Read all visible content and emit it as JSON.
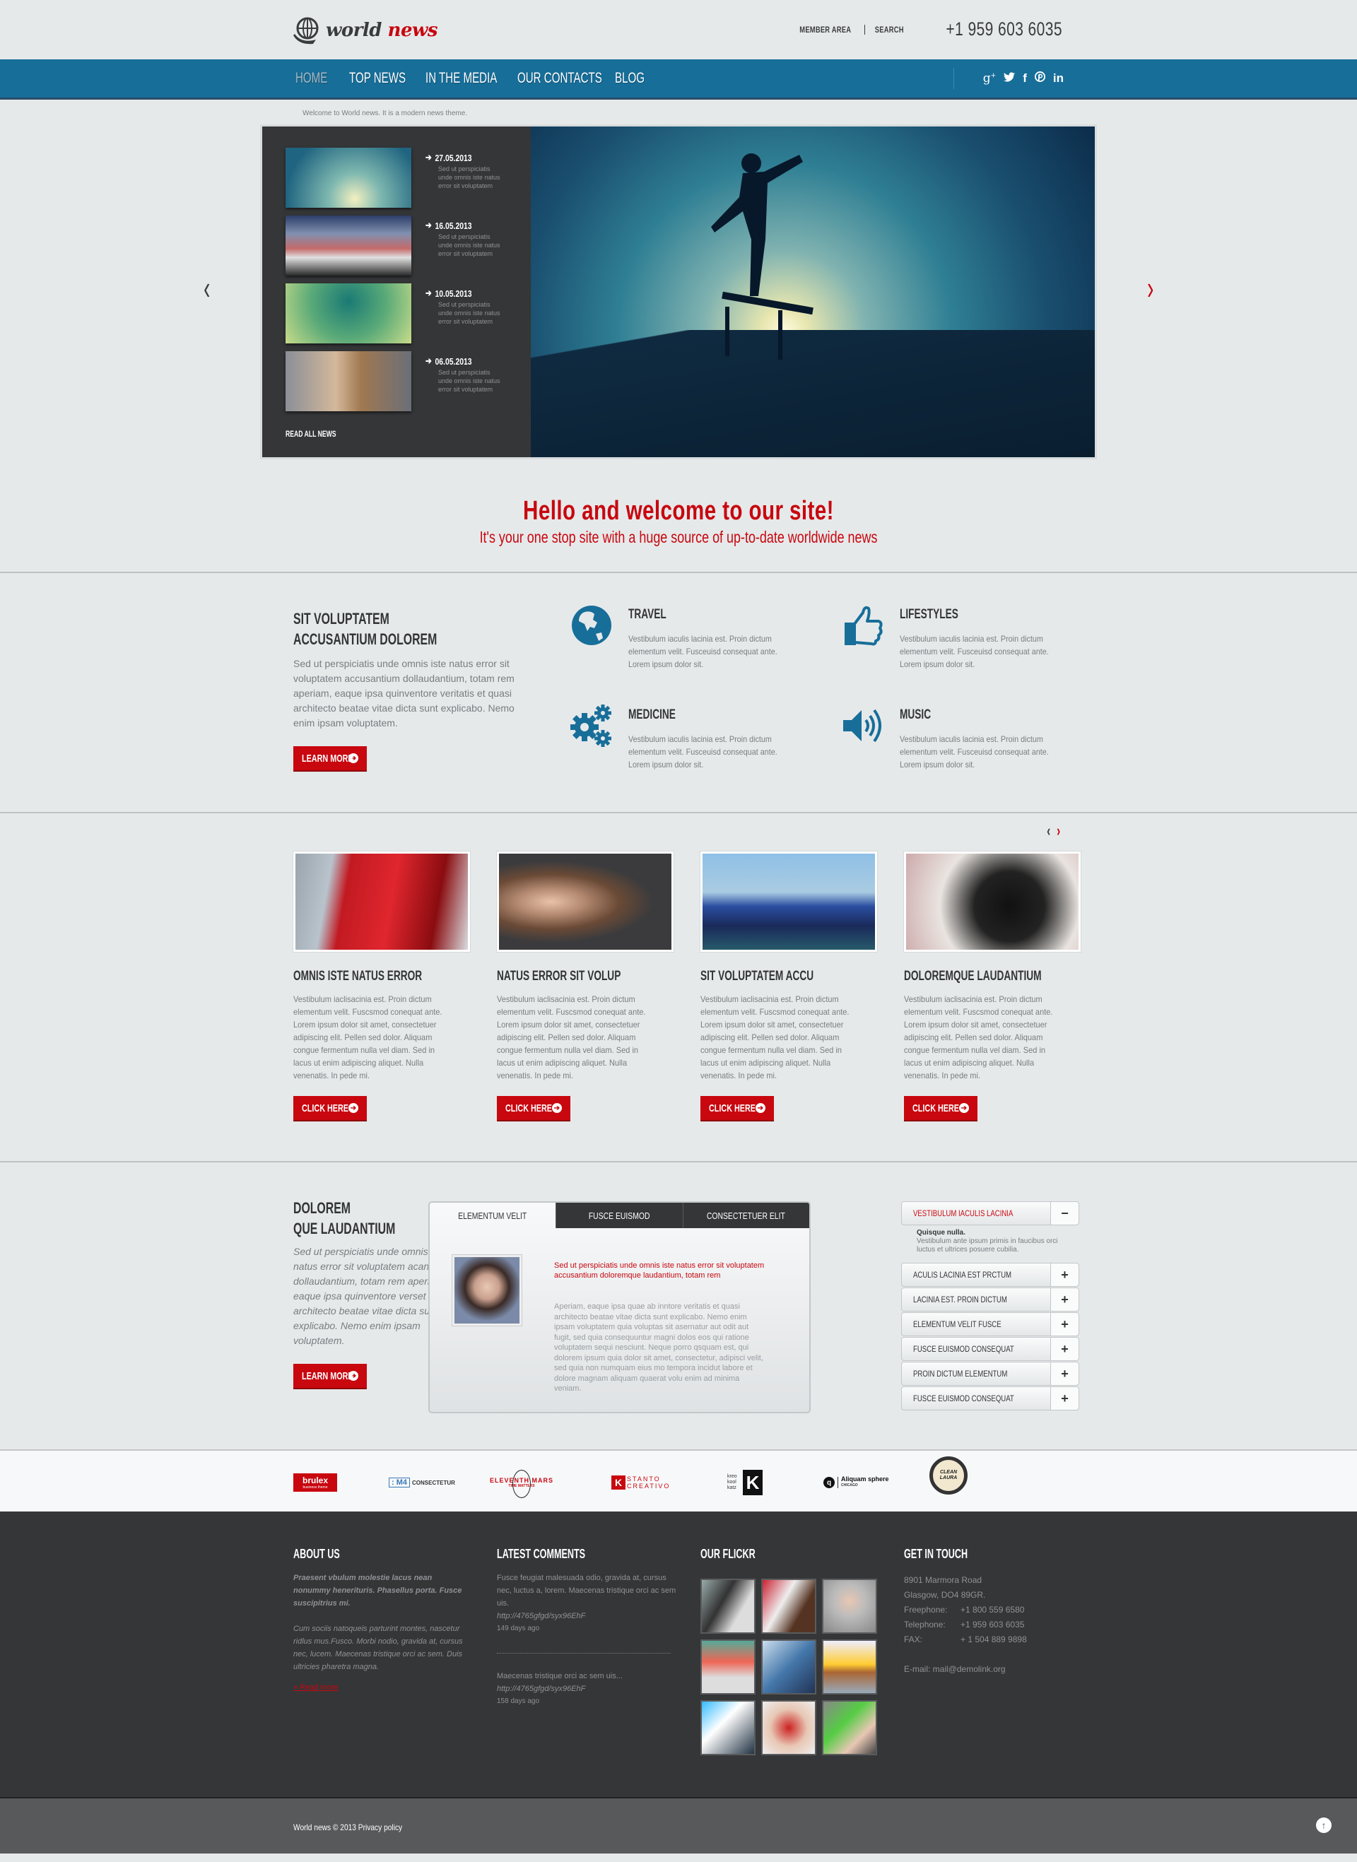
{
  "header": {
    "logo_word1": "world",
    "logo_word2": "news",
    "member_area": "MEMBER AREA",
    "search": "SEARCH",
    "phone": "+1 959 603 6035"
  },
  "nav": {
    "items": [
      {
        "label": "HOME",
        "active": true
      },
      {
        "label": "TOP NEWS"
      },
      {
        "label": "IN THE MEDIA"
      },
      {
        "label": "OUR CONTACTS"
      },
      {
        "label": "BLOG"
      }
    ],
    "social": [
      "g+",
      "twitter",
      "f",
      "pinterest",
      "in"
    ]
  },
  "welcome_text": "Welcome to World news. It is a modern news theme.",
  "slider": {
    "items": [
      {
        "date": "27.05.2013",
        "text": "Sed ut perspiciatis unde omnis iste natus error sit voluptatem"
      },
      {
        "date": "16.05.2013",
        "text": "Sed ut perspiciatis unde omnis iste natus error sit voluptatem"
      },
      {
        "date": "10.05.2013",
        "text": "Sed ut perspiciatis unde omnis iste natus error sit voluptatem"
      },
      {
        "date": "06.05.2013",
        "text": "Sed ut perspiciatis unde omnis iste natus error sit voluptatem"
      }
    ],
    "read_all": "READ ALL NEWS",
    "prev": "‹",
    "next": "›"
  },
  "hello": {
    "title": "Hello and welcome to our site!",
    "subtitle": "It's your one stop site with a huge source of up-to-date worldwide news"
  },
  "features": {
    "intro_title_1": "SIT VOLUPTATEM",
    "intro_title_2": "ACCUSANTIUM DOLOREM",
    "intro_text": "Sed ut perspiciatis unde omnis iste natus error sit voluptatem accusantium dollaudantium, totam rem aperiam, eaque ipsa quinventore veritatis et quasi architecto beatae vitae dicta sunt explicabo. Nemo enim ipsam voluptatem.",
    "learn_more": "LEARN MORE",
    "items": [
      {
        "title": "TRAVEL",
        "icon": "globe-icon",
        "text": "Vestibulum iaculis lacinia est. Proin dictum elementum velit. Fusceuisd consequat ante. Lorem ipsum dolor sit."
      },
      {
        "title": "LIFESTYLES",
        "icon": "thumbs-up-icon",
        "text": "Vestibulum iaculis lacinia est. Proin dictum elementum velit. Fusceuisd consequat ante. Lorem ipsum dolor sit."
      },
      {
        "title": "MEDICINE",
        "icon": "gears-icon",
        "text": "Vestibulum iaculis lacinia est. Proin dictum elementum velit. Fusceuisd consequat ante. Lorem ipsum dolor sit."
      },
      {
        "title": "MUSIC",
        "icon": "speaker-icon",
        "text": "Vestibulum iaculis lacinia est. Proin dictum elementum velit. Fusceuisd consequat ante. Lorem ipsum dolor sit."
      }
    ]
  },
  "articles": {
    "prev": "‹",
    "next": "›",
    "button": "CLICK HERE",
    "items": [
      {
        "title": "OMNIS ISTE NATUS ERROR",
        "text": "Vestibulum iaclisacinia est. Proin dictum elementum velit. Fuscsmod conequat ante. Lorem ipsum dolor sit amet, consectetuer adipiscing elit. Pellen sed dolor. Aliquam congue fermentum  nulla vel diam. Sed in lacus ut enim adipiscing aliquet. Nulla venenatis. In pede mi."
      },
      {
        "title": "NATUS ERROR SIT VOLUP",
        "text": "Vestibulum iaclisacinia est. Proin dictum elementum velit. Fuscsmod conequat ante. Lorem ipsum dolor sit amet, consectetuer adipiscing elit. Pellen sed dolor. Aliquam congue fermentum  nulla vel diam. Sed in lacus ut enim adipiscing aliquet. Nulla venenatis. In pede mi."
      },
      {
        "title": "SIT VOLUPTATEM ACCU",
        "text": "Vestibulum iaclisacinia est. Proin dictum elementum velit. Fuscsmod conequat ante. Lorem ipsum dolor sit amet, consectetuer adipiscing elit. Pellen sed dolor. Aliquam congue fermentum  nulla vel diam. Sed in lacus ut enim adipiscing aliquet. Nulla venenatis. In pede mi."
      },
      {
        "title": "DOLOREMQUE LAUDANTIUM",
        "text": "Vestibulum iaclisacinia est. Proin dictum elementum velit. Fuscsmod conequat ante. Lorem ipsum dolor sit amet, consectetuer adipiscing elit. Pellen sed dolor. Aliquam congue fermentum  nulla vel diam. Sed in lacus ut enim adipiscing aliquet. Nulla venenatis. In pede mi."
      }
    ]
  },
  "tabsection": {
    "title_1": "DOLOREM",
    "title_2": "QUE LAUDANTIUM",
    "text": "Sed ut perspiciatis unde omnis iste natus error sit voluptatem acantium dollaudantium, totam rem aperiam, eaque ipsa quinventore verset quasi architecto beatae vitae dicta sunt explicabo. Nemo enim ipsam voluptatem.",
    "learn_more": "LEARN MORE",
    "tabs": [
      {
        "label": "ELEMENTUM VELIT",
        "active": true
      },
      {
        "label": "FUSCE EUISMOD"
      },
      {
        "label": "CONSECTETUER ELIT"
      }
    ],
    "tab_highlight": "Sed ut perspiciatis unde omnis iste natus error sit voluptatem accusantium doloremque laudantium, totam rem",
    "tab_text": "Aperiam, eaque ipsa quae ab inntore veritatis et quasi architecto beatae vitae dicta sunt explicabo. Nemo enim ipsam voluptatem quia voluptas sit asernatur aut odit aut fugit, sed quia consequuntur magni dolos eos qui ratione voluptatem sequi nesciunt. Neque porro qsquam est, qui dolorem ipsum quia dolor sit amet, consectetur, adipisci velit, sed quia non numquam eius mo tempora incidut labore et dolore magnam aliquam quaerat volu enim ad minima veniam.",
    "accordion": {
      "open_label": "VESTIBULUM IACULIS LACINIA",
      "open_title": "Quisque nulla.",
      "open_text": "Vestibulum ante ipsum primis in faucibus orci luctus et ultrices posuere cubilia.",
      "items": [
        "ACULIS LACINIA EST PRCTUM",
        "LACINIA EST. PROIN DICTUM",
        "ELEMENTUM VELIT FUSCE",
        "FUSCE EUISMOD CONSEQUAT",
        "PROIN DICTUM ELEMENTUM",
        "FUSCE EUISMOD CONSEQUAT"
      ],
      "open_sign": "−",
      "closed_sign": "+"
    }
  },
  "partners": [
    {
      "name": "brulex",
      "sub": "business theme"
    },
    {
      "name": ": M4",
      "sub": "CONSECTETUR"
    },
    {
      "name": "ELEVENTH MARS",
      "sub": "TIME MATTERS"
    },
    {
      "name": "STANTO CREATIVO",
      "sub": "K"
    },
    {
      "name": "kreo kool katz",
      "sub": "K"
    },
    {
      "name": "Aliquam sphere",
      "sub": "CHICAGO"
    },
    {
      "name": "CLEAN LAURA",
      "sub": ""
    }
  ],
  "footer": {
    "about": {
      "title": "ABOUT US",
      "bold": "Praesent vbulum molestie lacus nean nonummy henerituris. Phasellus porta. Fusce suscipitrius mi.",
      "text": "Cum sociis natoqueis parturint montes, nascetur ridlus mus.Fusco. Morbi nodio, gravida at, cursus nec, lucem. Maecenas tristique orci ac sem. Duis ultricies pharetra magna.",
      "read_more": "Read more"
    },
    "comments": {
      "title": "LATEST COMMENTS",
      "items": [
        {
          "text": "Fusce feugiat malesuada odio, gravida at, cursus nec, luctus a, lorem. Maecenas tristique orci ac sem uis.",
          "link": "http://4765gfgd/syx96EhF",
          "age": "149 days ago"
        },
        {
          "text": "Maecenas tristique orci ac sem uis...",
          "link": "http://4765gfgd/syx96EhF",
          "age": "158 days ago"
        }
      ]
    },
    "flickr": {
      "title": "OUR FLICKR",
      "count": 9
    },
    "contact": {
      "title": "GET IN TOUCH",
      "address_1": "8901 Marmora Road",
      "address_2": "Glasgow, DO4 89GR.",
      "rows": [
        {
          "k": "Freephone:",
          "v": "+1 800 559 6580"
        },
        {
          "k": "Telephone:",
          "v": "+1 959 603 6035"
        },
        {
          "k": "FAX:",
          "v": "+ 1 504 889 9898"
        }
      ],
      "email": "E-mail: mail@demolink.org"
    },
    "copyright": "World news © 2013 Privacy policy"
  },
  "colors": {
    "accent_red": "#c8070f",
    "nav_blue": "#176e99",
    "icon_blue": "#176e99",
    "dark": "#353638",
    "background": "#e6e9ea"
  }
}
